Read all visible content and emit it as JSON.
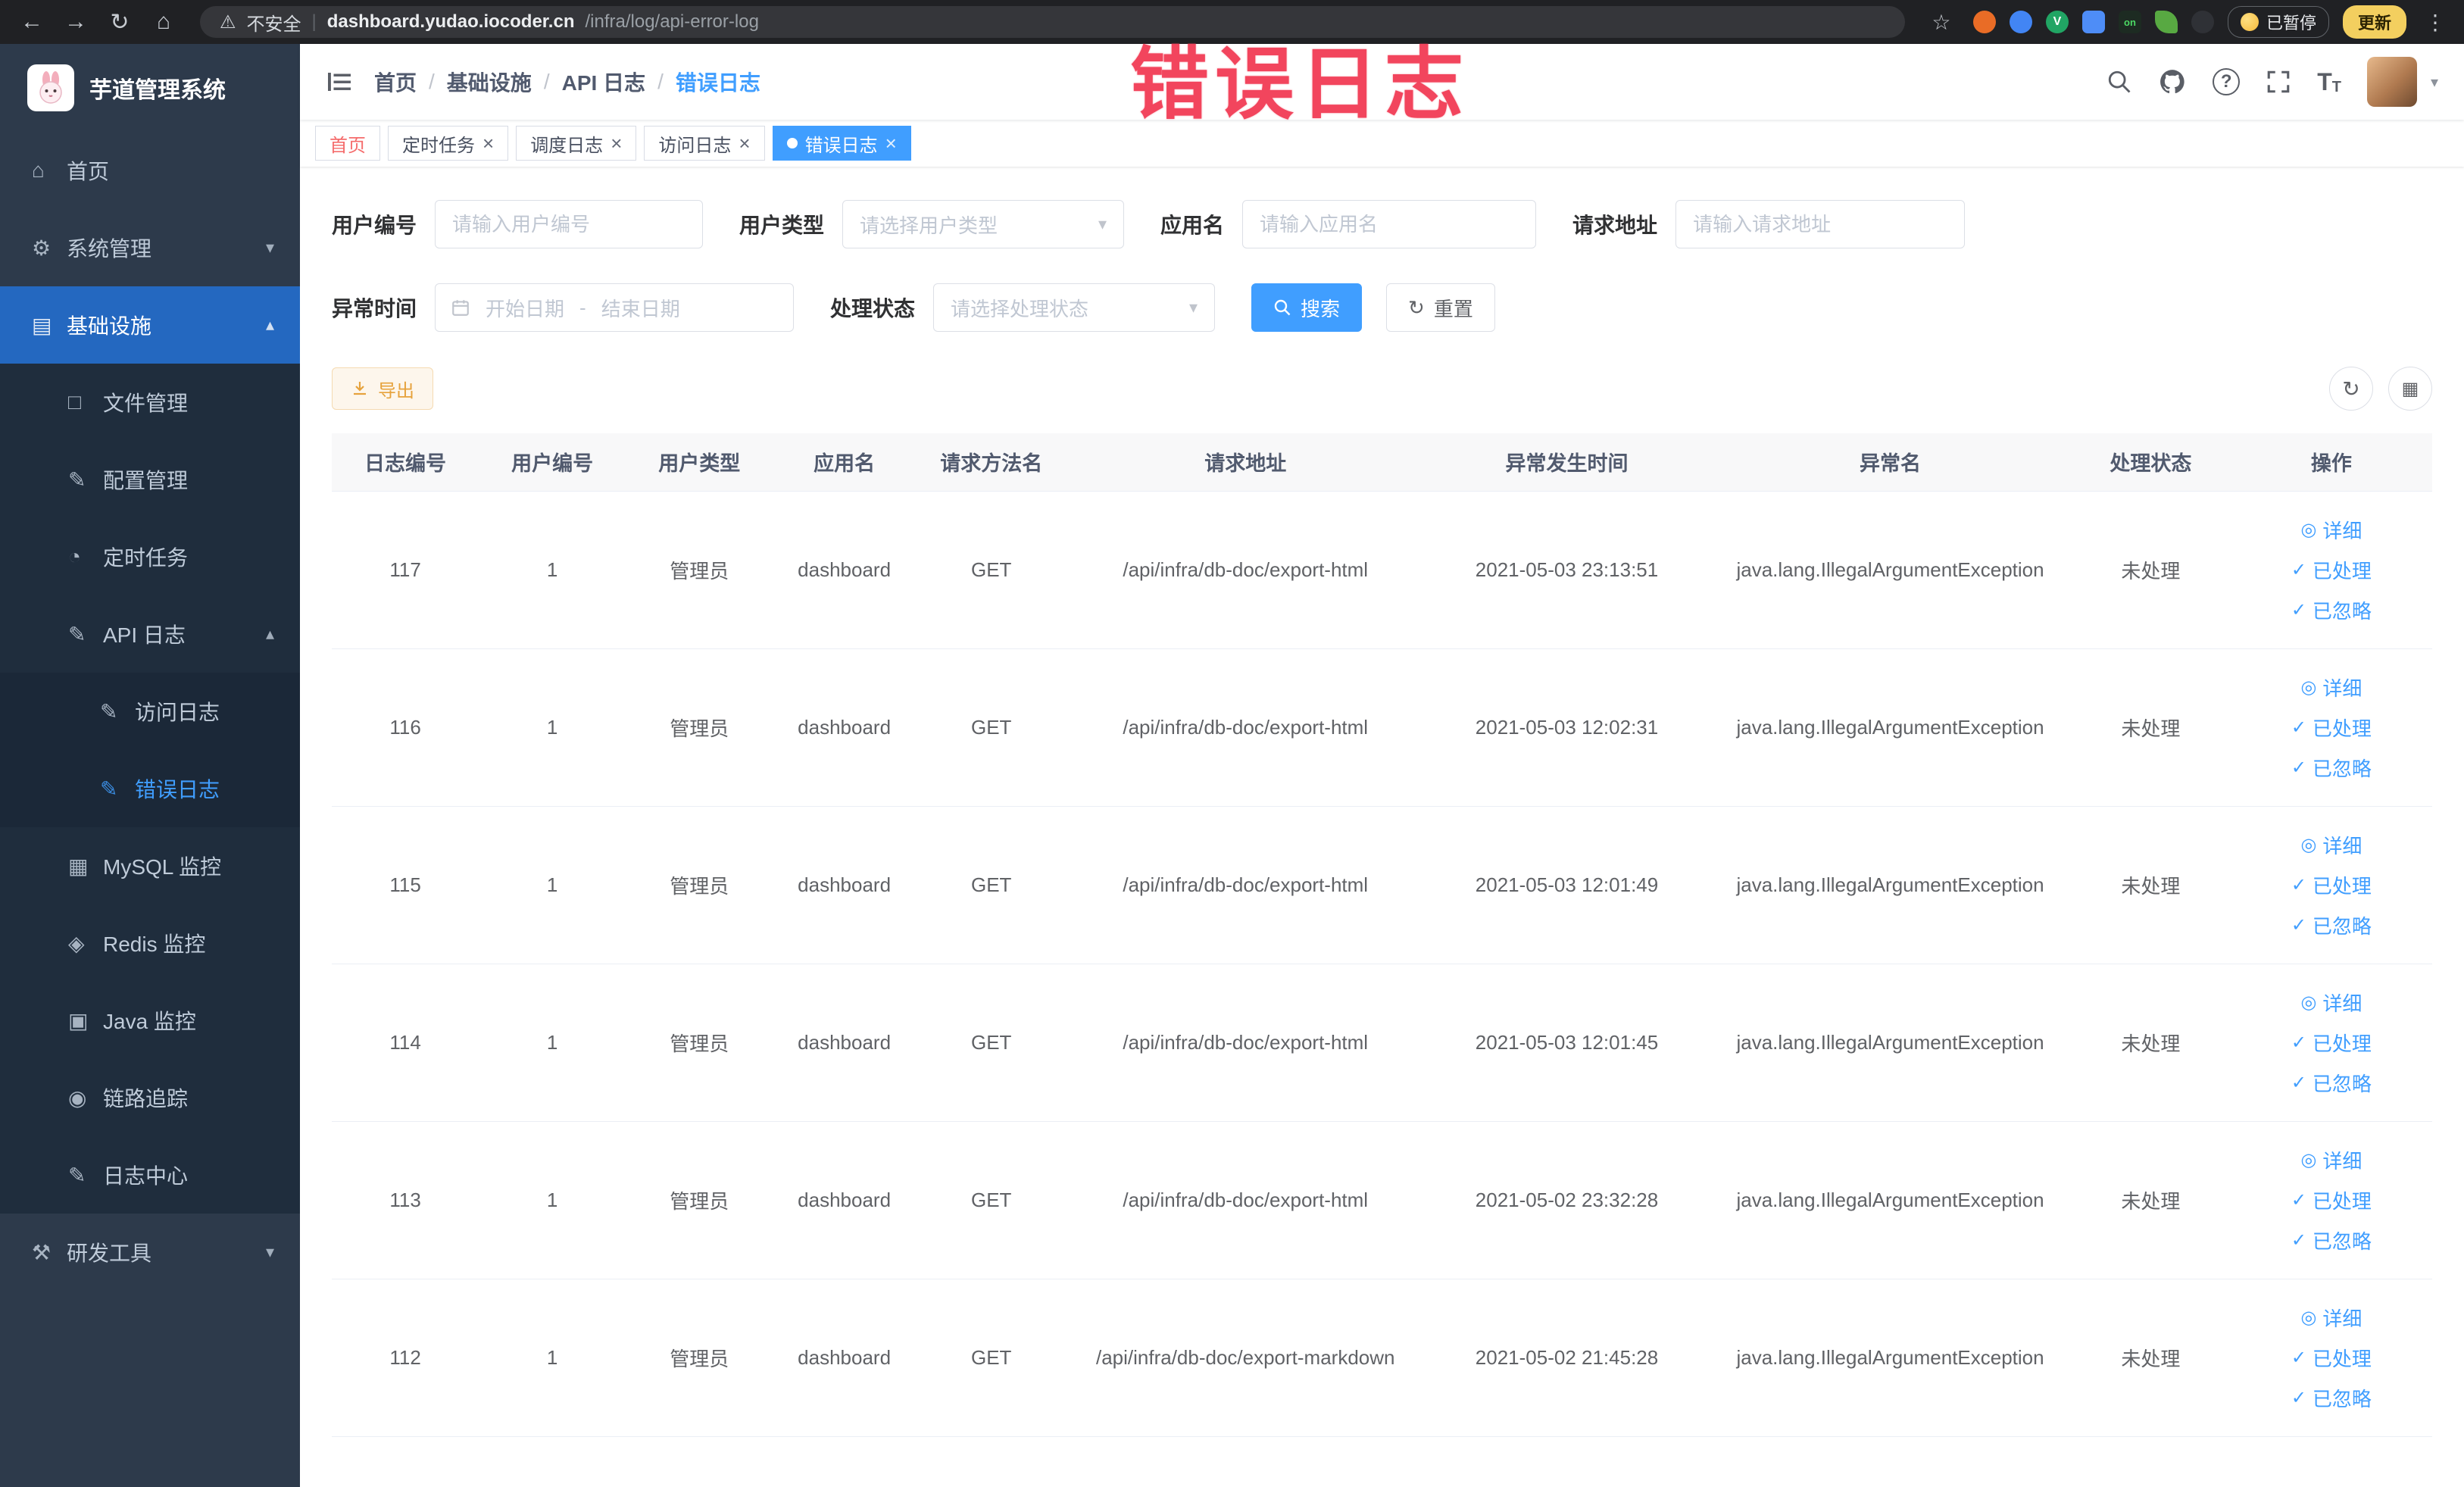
{
  "browser": {
    "security_label": "不安全",
    "url_host": "dashboard.yudao.iocoder.cn",
    "url_path": "/infra/log/api-error-log",
    "paused_label": "已暂停",
    "update_label": "更新",
    "extension_on_label": "on",
    "icons": {
      "back": "←",
      "forward": "→",
      "reload": "↻",
      "home": "⌂",
      "warning": "⚠",
      "star": "☆",
      "menu": "⋮",
      "divider": "|",
      "ext_v": "V"
    }
  },
  "annotation": {
    "text": "错误日志"
  },
  "sidebar": {
    "title": "芋道管理系统",
    "items": [
      {
        "name": "home",
        "label": "首页",
        "icon": "home-icon",
        "glyph": "⌂",
        "level": 0
      },
      {
        "name": "system-management",
        "label": "系统管理",
        "icon": "gear-icon",
        "glyph": "⚙",
        "level": 0,
        "chevron": "down"
      },
      {
        "name": "infrastructure",
        "label": "基础设施",
        "icon": "infra-icon",
        "glyph": "▤",
        "level": 0,
        "chevron": "up",
        "highlight": true
      },
      {
        "name": "file-management",
        "label": "文件管理",
        "icon": "file-icon",
        "glyph": "□",
        "level": 1
      },
      {
        "name": "config-management",
        "label": "配置管理",
        "icon": "edit-icon",
        "glyph": "✎",
        "level": 1
      },
      {
        "name": "scheduled-tasks",
        "label": "定时任务",
        "icon": "timer-icon",
        "glyph": "◔",
        "level": 1
      },
      {
        "name": "api-log",
        "label": "API 日志",
        "icon": "api-log-icon",
        "glyph": "✎",
        "level": 1,
        "chevron": "up"
      },
      {
        "name": "access-log",
        "label": "访问日志",
        "icon": "access-log-icon",
        "glyph": "✎",
        "level": 2
      },
      {
        "name": "error-log",
        "label": "错误日志",
        "icon": "error-log-icon",
        "glyph": "✎",
        "level": 2,
        "active": true
      },
      {
        "name": "mysql-monitor",
        "label": "MySQL 监控",
        "icon": "mysql-icon",
        "glyph": "▦",
        "level": 1
      },
      {
        "name": "redis-monitor",
        "label": "Redis 监控",
        "icon": "redis-icon",
        "glyph": "◈",
        "level": 1
      },
      {
        "name": "java-monitor",
        "label": "Java 监控",
        "icon": "java-icon",
        "glyph": "▣",
        "level": 1
      },
      {
        "name": "trace",
        "label": "链路追踪",
        "icon": "trace-icon",
        "glyph": "◉",
        "level": 1
      },
      {
        "name": "log-center",
        "label": "日志中心",
        "icon": "log-center-icon",
        "glyph": "✎",
        "level": 1
      },
      {
        "name": "dev-tools",
        "label": "研发工具",
        "icon": "tools-icon",
        "glyph": "⚒",
        "level": 0,
        "chevron": "down"
      }
    ]
  },
  "header": {
    "breadcrumbs": [
      "首页",
      "基础设施",
      "API 日志",
      "错误日志"
    ]
  },
  "tabs": [
    {
      "name": "home",
      "label": "首页",
      "closable": false,
      "affix": true
    },
    {
      "name": "timed-task",
      "label": "定时任务",
      "closable": true
    },
    {
      "name": "schedule-log",
      "label": "调度日志",
      "closable": true
    },
    {
      "name": "access-log",
      "label": "访问日志",
      "closable": true
    },
    {
      "name": "error-log",
      "label": "错误日志",
      "closable": true,
      "active": true
    }
  ],
  "filters": {
    "user_id": {
      "label": "用户编号",
      "placeholder": "请输入用户编号"
    },
    "user_type": {
      "label": "用户类型",
      "placeholder": "请选择用户类型"
    },
    "app_name": {
      "label": "应用名",
      "placeholder": "请输入应用名"
    },
    "request_url": {
      "label": "请求地址",
      "placeholder": "请输入请求地址"
    },
    "exception_time": {
      "label": "异常时间",
      "start_placeholder": "开始日期",
      "separator": "-",
      "end_placeholder": "结束日期"
    },
    "process_status": {
      "label": "处理状态",
      "placeholder": "请选择处理状态"
    },
    "search_label": "搜索",
    "reset_label": "重置"
  },
  "toolbar": {
    "export_label": "导出"
  },
  "table": {
    "columns": [
      "日志编号",
      "用户编号",
      "用户类型",
      "应用名",
      "请求方法名",
      "请求地址",
      "异常发生时间",
      "异常名",
      "处理状态",
      "操作"
    ],
    "actions": [
      {
        "name": "detail",
        "label": "详细",
        "glyph": "◎",
        "icon": "eye-icon"
      },
      {
        "name": "mark-processed",
        "label": "已处理",
        "glyph": "✓",
        "icon": "check-icon"
      },
      {
        "name": "mark-ignored",
        "label": "已忽略",
        "glyph": "✓",
        "icon": "check-icon"
      }
    ],
    "rows": [
      {
        "id": "117",
        "user_id": "1",
        "user_type": "管理员",
        "app": "dashboard",
        "method": "GET",
        "url": "/api/infra/db-doc/export-html",
        "time": "2021-05-03 23:13:51",
        "exception": "java.lang.IllegalArgumentException",
        "status": "未处理"
      },
      {
        "id": "116",
        "user_id": "1",
        "user_type": "管理员",
        "app": "dashboard",
        "method": "GET",
        "url": "/api/infra/db-doc/export-html",
        "time": "2021-05-03 12:02:31",
        "exception": "java.lang.IllegalArgumentException",
        "status": "未处理"
      },
      {
        "id": "115",
        "user_id": "1",
        "user_type": "管理员",
        "app": "dashboard",
        "method": "GET",
        "url": "/api/infra/db-doc/export-html",
        "time": "2021-05-03 12:01:49",
        "exception": "java.lang.IllegalArgumentException",
        "status": "未处理"
      },
      {
        "id": "114",
        "user_id": "1",
        "user_type": "管理员",
        "app": "dashboard",
        "method": "GET",
        "url": "/api/infra/db-doc/export-html",
        "time": "2021-05-03 12:01:45",
        "exception": "java.lang.IllegalArgumentException",
        "status": "未处理"
      },
      {
        "id": "113",
        "user_id": "1",
        "user_type": "管理员",
        "app": "dashboard",
        "method": "GET",
        "url": "/api/infra/db-doc/export-html",
        "time": "2021-05-02 23:32:28",
        "exception": "java.lang.IllegalArgumentException",
        "status": "未处理"
      },
      {
        "id": "112",
        "user_id": "1",
        "user_type": "管理员",
        "app": "dashboard",
        "method": "GET",
        "url": "/api/infra/db-doc/export-markdown",
        "time": "2021-05-02 21:45:28",
        "exception": "java.lang.IllegalArgumentException",
        "status": "未处理"
      }
    ]
  }
}
